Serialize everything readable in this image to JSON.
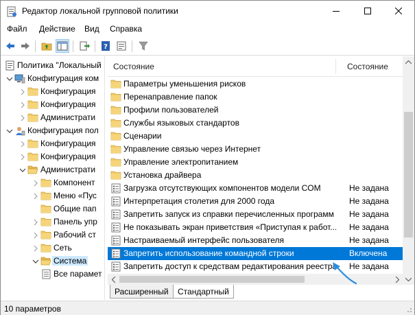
{
  "window": {
    "title": "Редактор локальной групповой политики",
    "controls": {
      "minimize": "minimize",
      "maximize": "maximize",
      "close": "close"
    }
  },
  "menu": [
    {
      "label": "Файл"
    },
    {
      "label": "Действие"
    },
    {
      "label": "Вид"
    },
    {
      "label": "Справка"
    }
  ],
  "toolbar": {
    "buttons": [
      "back-arrow-icon",
      "forward-arrow-icon",
      "up-folder-icon",
      "show-hide-tree-icon",
      "export-list-icon",
      "help-icon",
      "properties-icon",
      "filter-icon"
    ]
  },
  "tree": [
    {
      "label": "Политика \"Локальный",
      "level": 0,
      "icon": "policy-icon",
      "expander": "none"
    },
    {
      "label": "Конфигурация ком",
      "level": 1,
      "icon": "computer-icon",
      "expander": "expanded"
    },
    {
      "label": "Конфигурация",
      "level": 2,
      "icon": "folder-icon",
      "expander": "collapsed"
    },
    {
      "label": "Конфигурация",
      "level": 2,
      "icon": "folder-icon",
      "expander": "collapsed"
    },
    {
      "label": "Администрати",
      "level": 2,
      "icon": "folder-icon",
      "expander": "collapsed"
    },
    {
      "label": "Конфигурация пол",
      "level": 1,
      "icon": "user-icon",
      "expander": "expanded"
    },
    {
      "label": "Конфигурация",
      "level": 2,
      "icon": "folder-icon",
      "expander": "collapsed"
    },
    {
      "label": "Конфигурация",
      "level": 2,
      "icon": "folder-icon",
      "expander": "collapsed"
    },
    {
      "label": "Администрати",
      "level": 2,
      "icon": "folder-open-icon",
      "expander": "expanded"
    },
    {
      "label": "Компонент",
      "level": 3,
      "icon": "folder-icon",
      "expander": "collapsed"
    },
    {
      "label": "Меню «Пус",
      "level": 3,
      "icon": "folder-icon",
      "expander": "collapsed"
    },
    {
      "label": "Общие пап",
      "level": 3,
      "icon": "folder-icon",
      "expander": "none"
    },
    {
      "label": "Панель упр",
      "level": 3,
      "icon": "folder-icon",
      "expander": "collapsed"
    },
    {
      "label": "Рабочий ст",
      "level": 3,
      "icon": "folder-icon",
      "expander": "collapsed"
    },
    {
      "label": "Сеть",
      "level": 3,
      "icon": "folder-icon",
      "expander": "collapsed"
    },
    {
      "label": "Система",
      "level": 3,
      "icon": "folder-open-icon",
      "expander": "expanded",
      "selected": true
    },
    {
      "label": "Все парамет",
      "level": 3,
      "icon": "settings-list-icon",
      "expander": "none"
    }
  ],
  "list": {
    "columns": [
      "Состояние",
      "Состояние"
    ],
    "rows": [
      {
        "name": "Параметры уменьшения рисков",
        "state": "",
        "icon": "folder-icon"
      },
      {
        "name": "Перенаправление папок",
        "state": "",
        "icon": "folder-icon"
      },
      {
        "name": "Профили пользователей",
        "state": "",
        "icon": "folder-icon"
      },
      {
        "name": "Службы языковых стандартов",
        "state": "",
        "icon": "folder-icon"
      },
      {
        "name": "Сценарии",
        "state": "",
        "icon": "folder-icon"
      },
      {
        "name": "Управление связью через Интернет",
        "state": "",
        "icon": "folder-icon"
      },
      {
        "name": "Управление электропитанием",
        "state": "",
        "icon": "folder-icon"
      },
      {
        "name": "Установка драйвера",
        "state": "",
        "icon": "folder-icon"
      },
      {
        "name": "Загрузка отсутствующих компонентов модели COM",
        "state": "Не задана",
        "icon": "setting-icon"
      },
      {
        "name": "Интерпретация столетия для 2000 года",
        "state": "Не задана",
        "icon": "setting-icon"
      },
      {
        "name": "Запретить запуск из справки перечисленных программ",
        "state": "Не задана",
        "icon": "setting-icon"
      },
      {
        "name": "Не показывать экран приветствия «Приступая к работ...",
        "state": "Не задана",
        "icon": "setting-icon"
      },
      {
        "name": "Настраиваемый интерфейс пользователя",
        "state": "Не задана",
        "icon": "setting-icon"
      },
      {
        "name": "Запретить использование командной строки",
        "state": "Включена",
        "icon": "setting-icon",
        "selected": true
      },
      {
        "name": "Запретить доступ к средствам редактирования реестра",
        "state": "Не задана",
        "icon": "setting-icon"
      }
    ]
  },
  "tabs": [
    {
      "label": "Расширенный",
      "active": false
    },
    {
      "label": "Стандартный",
      "active": true
    }
  ],
  "status": {
    "text": "10 параметров"
  },
  "colors": {
    "selection": "#0078d7",
    "folder": "#e8b84a",
    "annotation_arrow": "#2a8ee0"
  }
}
